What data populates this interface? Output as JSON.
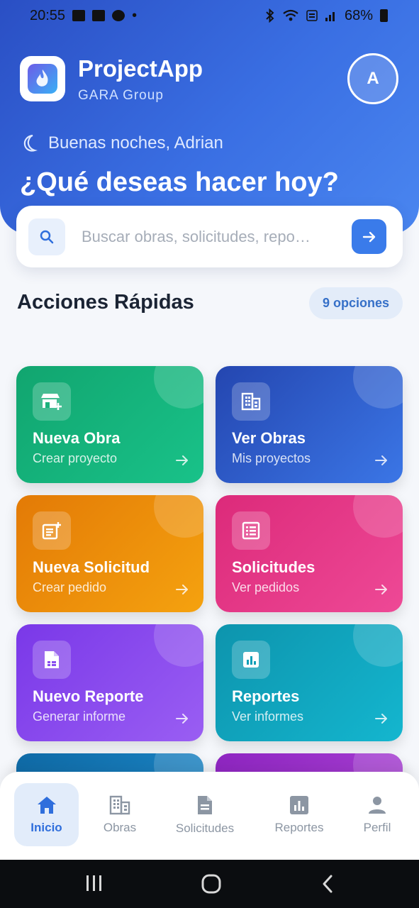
{
  "status_bar": {
    "time": "20:55",
    "notif_dot": "•",
    "battery": "68%",
    "icons": [
      "gallery-icon",
      "youtube-icon",
      "soccer-icon",
      "bluetooth-icon",
      "wifi-icon",
      "lte-icon",
      "signal-icon",
      "battery-icon"
    ]
  },
  "header": {
    "app_name": "ProjectApp",
    "company": "GARA Group",
    "avatar_letter": "A",
    "greeting": "Buenas noches, Adrian",
    "question": "¿Qué deseas hacer hoy?"
  },
  "search": {
    "placeholder": "Buscar obras, solicitudes, repo…",
    "value": ""
  },
  "quick_actions": {
    "title": "Acciones Rápidas",
    "badge": "9 opciones",
    "cards": [
      {
        "title": "Nueva Obra",
        "subtitle": "Crear proyecto",
        "icon": "store-add-icon",
        "color": "#11a56f"
      },
      {
        "title": "Ver Obras",
        "subtitle": "Mis proyectos",
        "icon": "building-icon",
        "color": "#2446b0"
      },
      {
        "title": "Nueva Solicitud",
        "subtitle": "Crear pedido",
        "icon": "document-add-icon",
        "color": "#e37a06"
      },
      {
        "title": "Solicitudes",
        "subtitle": "Ver pedidos",
        "icon": "list-icon",
        "color": "#dc2a7a"
      },
      {
        "title": "Nuevo Reporte",
        "subtitle": "Generar informe",
        "icon": "report-file-icon",
        "color": "#7a38e8"
      },
      {
        "title": "Reportes",
        "subtitle": "Ver informes",
        "icon": "bar-chart-icon",
        "color": "#0d94ad"
      }
    ]
  },
  "bottom_nav": {
    "items": [
      {
        "label": "Inicio",
        "icon": "home-icon",
        "active": true
      },
      {
        "label": "Obras",
        "icon": "building-icon",
        "active": false
      },
      {
        "label": "Solicitudes",
        "icon": "document-icon",
        "active": false
      },
      {
        "label": "Reportes",
        "icon": "bar-chart-icon",
        "active": false
      },
      {
        "label": "Perfil",
        "icon": "person-icon",
        "active": false
      }
    ]
  },
  "colors": {
    "accent": "#3a7bea",
    "header_start": "#2a4fc4",
    "header_end": "#4a86f0"
  }
}
